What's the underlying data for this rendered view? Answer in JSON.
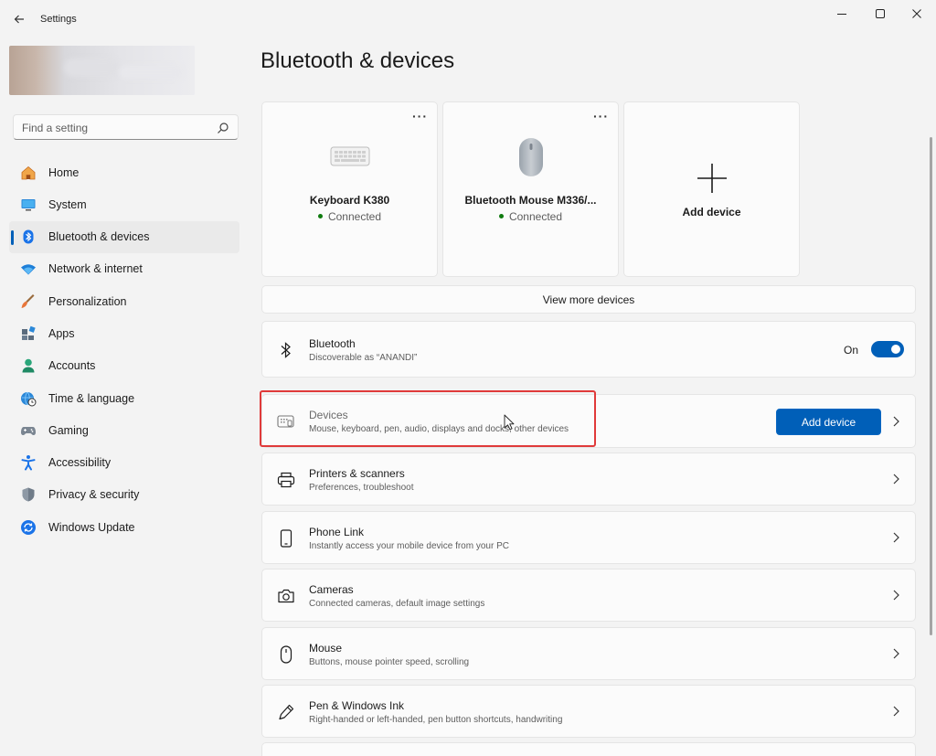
{
  "window": {
    "title": "Settings"
  },
  "sidebar": {
    "search_placeholder": "Find a setting",
    "items": [
      {
        "label": "Home",
        "icon": "home-icon"
      },
      {
        "label": "System",
        "icon": "monitor-icon"
      },
      {
        "label": "Bluetooth & devices",
        "icon": "bluetooth-icon",
        "active": true
      },
      {
        "label": "Network & internet",
        "icon": "wifi-icon"
      },
      {
        "label": "Personalization",
        "icon": "brush-icon"
      },
      {
        "label": "Apps",
        "icon": "apps-icon"
      },
      {
        "label": "Accounts",
        "icon": "person-icon"
      },
      {
        "label": "Time & language",
        "icon": "globe-clock-icon"
      },
      {
        "label": "Gaming",
        "icon": "gamepad-icon"
      },
      {
        "label": "Accessibility",
        "icon": "accessibility-icon"
      },
      {
        "label": "Privacy & security",
        "icon": "shield-icon"
      },
      {
        "label": "Windows Update",
        "icon": "update-icon"
      }
    ]
  },
  "main": {
    "title": "Bluetooth & devices",
    "device_cards": [
      {
        "name": "Keyboard K380",
        "status": "Connected",
        "icon": "keyboard-icon"
      },
      {
        "name": "Bluetooth Mouse M336/...",
        "status": "Connected",
        "icon": "mouse-icon"
      }
    ],
    "add_card_label": "Add device",
    "view_more": "View more devices",
    "bluetooth": {
      "title": "Bluetooth",
      "subtitle": "Discoverable as “ANANDI”",
      "toggle_label": "On",
      "toggle_on": true
    },
    "devices_row": {
      "title": "Devices",
      "subtitle": "Mouse, keyboard, pen, audio, displays and docks, other devices",
      "button_label": "Add device"
    },
    "rows": [
      {
        "title": "Printers & scanners",
        "subtitle": "Preferences, troubleshoot",
        "icon": "printer-icon"
      },
      {
        "title": "Phone Link",
        "subtitle": "Instantly access your mobile device from your PC",
        "icon": "phone-icon"
      },
      {
        "title": "Cameras",
        "subtitle": "Connected cameras, default image settings",
        "icon": "camera-icon"
      },
      {
        "title": "Mouse",
        "subtitle": "Buttons, mouse pointer speed, scrolling",
        "icon": "mouse-outline-icon"
      },
      {
        "title": "Pen & Windows Ink",
        "subtitle": "Right-handed or left-handed, pen button shortcuts, handwriting",
        "icon": "pen-icon"
      }
    ]
  },
  "colors": {
    "accent": "#005fb8",
    "highlight": "#e03a3a",
    "connected": "#0f7b0f"
  }
}
